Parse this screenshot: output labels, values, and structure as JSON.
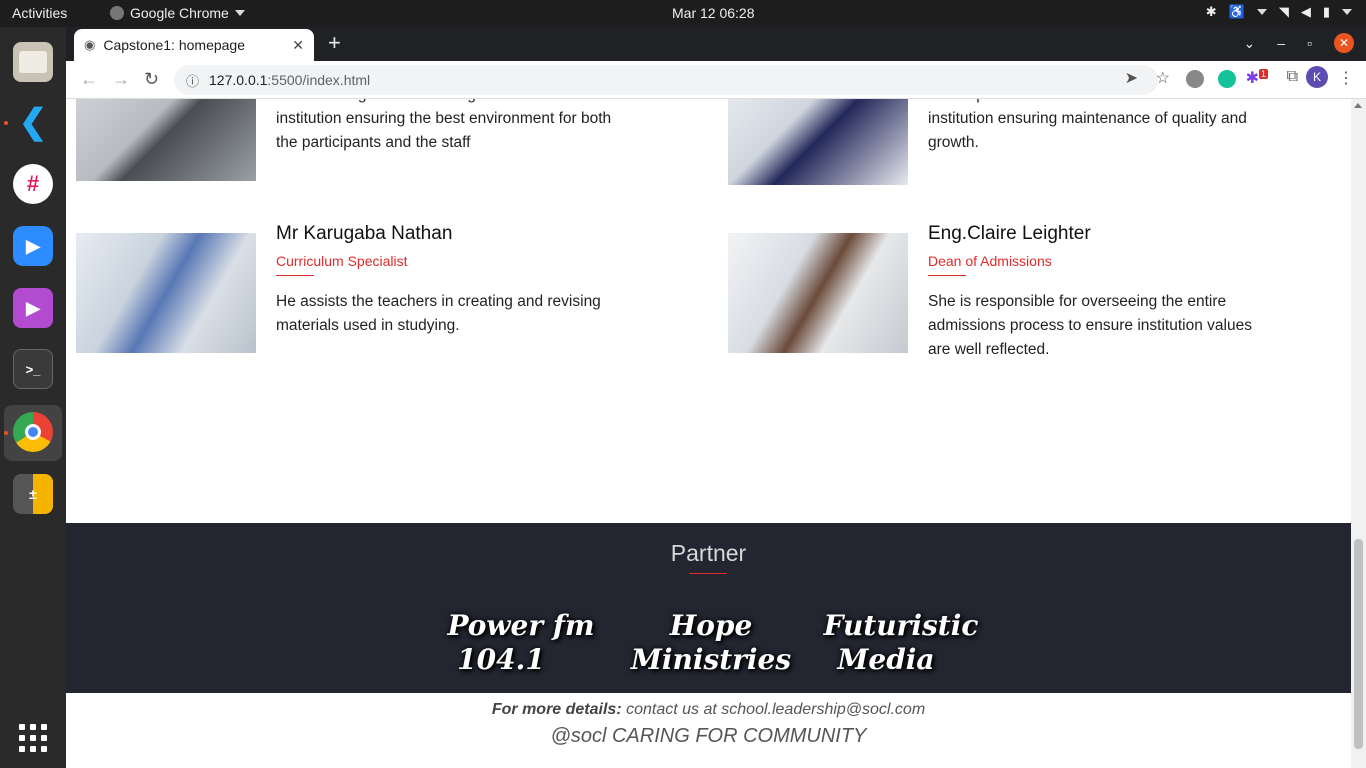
{
  "system": {
    "activities": "Activities",
    "app_name": "Google Chrome",
    "clock": "Mar 12  06:28"
  },
  "browser": {
    "tab_title": "Capstone1: homepage",
    "url_host": "127.0.0.1",
    "url_path": ":5500/index.html",
    "profile_initial": "K",
    "extension_badge": "1"
  },
  "team": [
    {
      "name": "",
      "role": "",
      "description": "He is incharge of overlooking activites in the institution ensuring the best environment for both the participants and the staff"
    },
    {
      "name": "",
      "role": "",
      "description": "She supervises and stirrs all activites in the institution ensuring maintenance of quality and growth."
    },
    {
      "name": "Mr Karugaba Nathan",
      "role": "Curriculum Specialist",
      "description": "He assists the teachers in creating and revising materials used in studying."
    },
    {
      "name": "Eng.Claire Leighter",
      "role": "Dean of Admissions",
      "description": "She is responsible for overseeing the entire admissions process to ensure institution values are well reflected."
    }
  ],
  "partners": {
    "title": "Partner",
    "items": [
      {
        "line1": "Power fm",
        "line2": "104.1"
      },
      {
        "line1": "Hope",
        "line2": "Ministries"
      },
      {
        "line1": "Futuristic",
        "line2": "Media"
      }
    ]
  },
  "footer": {
    "details_label": "For more details:",
    "details_text": " contact us at school.leadership@socl.com",
    "tagline": "@socl CARING FOR COMMUNITY"
  },
  "colors": {
    "accent": "#e02b2b",
    "footer_bg": "#232631"
  }
}
